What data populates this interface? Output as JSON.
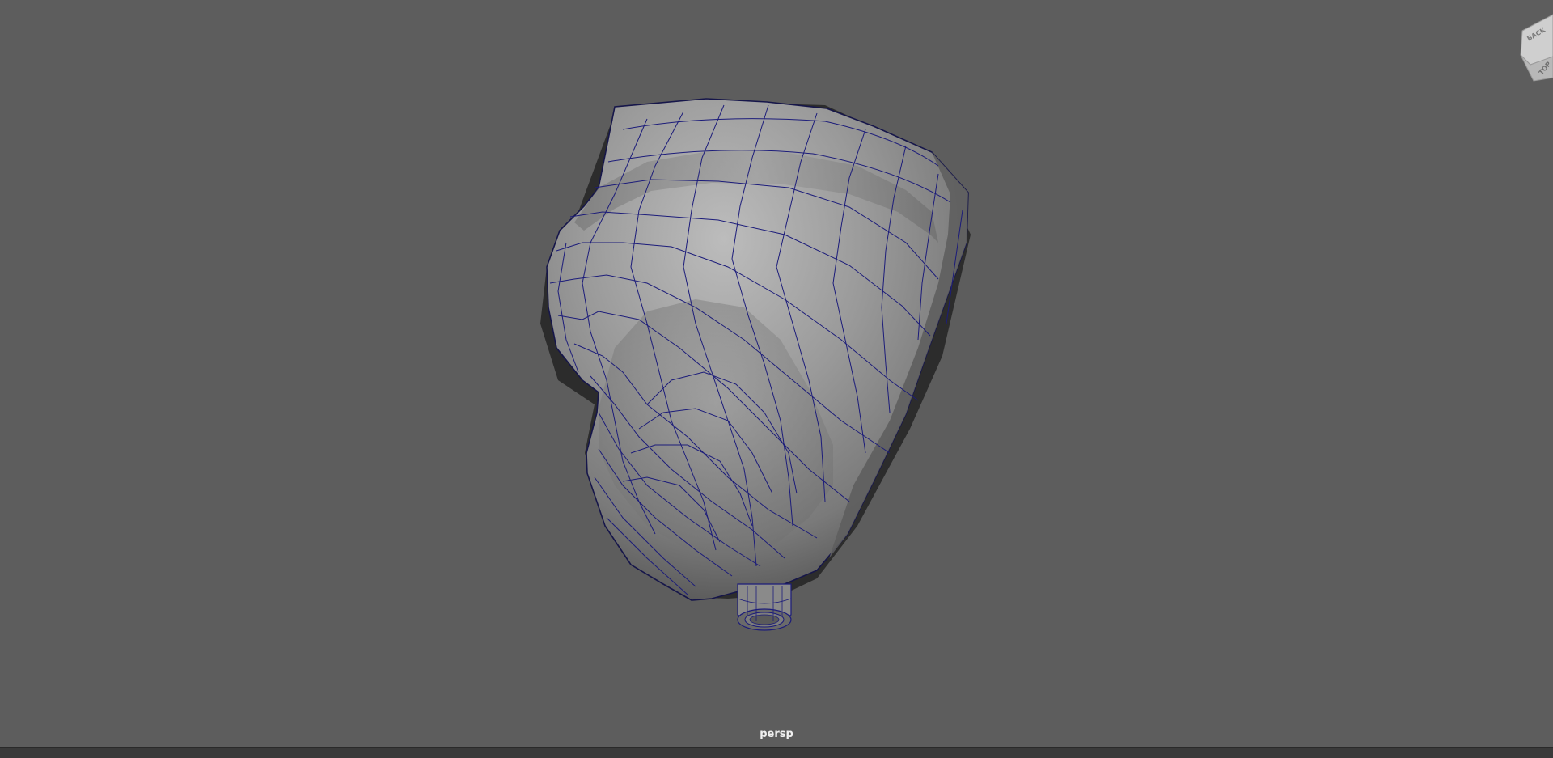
{
  "viewport": {
    "camera_name": "persp",
    "view_cube": {
      "face_back": "BACK",
      "face_top": "TOP"
    }
  },
  "colors": {
    "background": "#5d5d5d",
    "wireframe": "#1c1c7a",
    "mesh_light": "#b5b5b5",
    "mesh_dark": "#3a3a3a"
  }
}
